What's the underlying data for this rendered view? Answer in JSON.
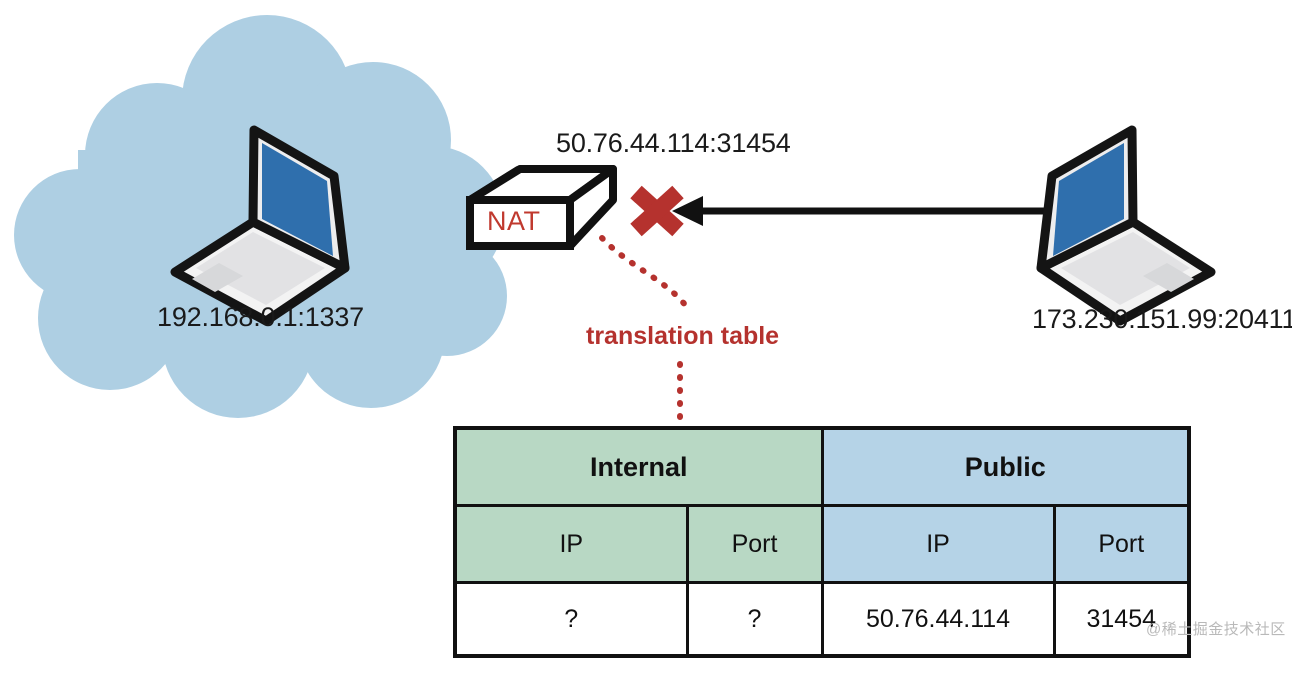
{
  "diagram": {
    "title_label": "50.76.44.114:31454",
    "internal_host_label": "192.168.0.1:1337",
    "external_host_label": "173.230.151.99:20411",
    "nat_device_label": "NAT",
    "annotation_label": "translation table",
    "colors": {
      "cloud": "#aecfe3",
      "screen_blue": "#2f6fad",
      "nat_text_red": "#c0392e",
      "block_red": "#b5322e",
      "annotation_red": "#b5322e",
      "table_internal_green": "#b8d8c4",
      "table_public_blue": "#b5d3e7",
      "stroke_black": "#111111"
    },
    "icons": {
      "cloud": "cloud-icon",
      "internal_laptop": "laptop-icon",
      "external_laptop": "laptop-icon",
      "nat_router": "router-box-icon",
      "blocked": "cross-block-icon",
      "connection": "arrow-left-icon",
      "annotation_leader": "dotted-leader-icon"
    }
  },
  "table": {
    "group_headers": [
      "Internal",
      "Public"
    ],
    "sub_headers": [
      "IP",
      "Port",
      "IP",
      "Port"
    ],
    "rows": [
      [
        "?",
        "?",
        "50.76.44.114",
        "31454"
      ]
    ]
  },
  "watermark": {
    "text": "@稀土掘金技术社区"
  }
}
